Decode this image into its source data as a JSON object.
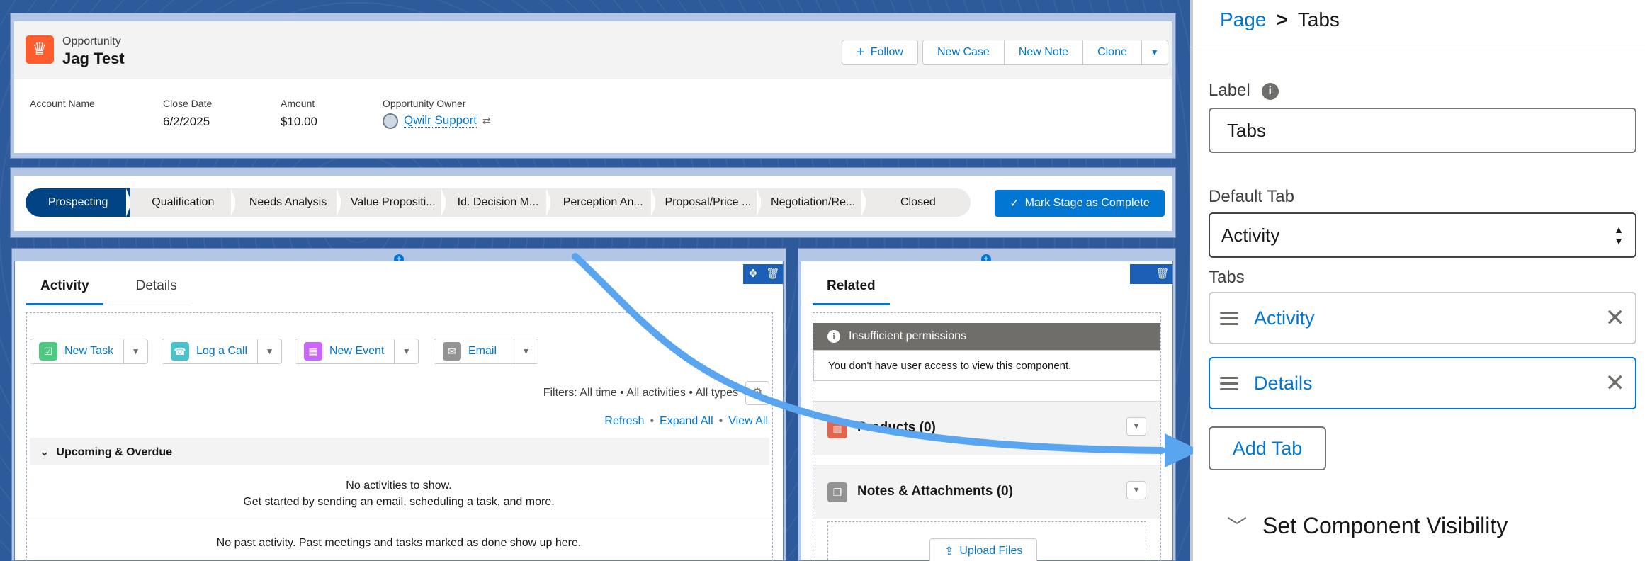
{
  "record": {
    "type": "Opportunity",
    "name": "Jag Test",
    "buttons": {
      "follow": "Follow",
      "new_case": "New Case",
      "new_note": "New Note",
      "clone": "Clone"
    },
    "fields": [
      {
        "label": "Account Name",
        "value": ""
      },
      {
        "label": "Close Date",
        "value": "6/2/2025"
      },
      {
        "label": "Amount",
        "value": "$10.00"
      },
      {
        "label": "Opportunity Owner",
        "value": "Qwilr Support"
      }
    ]
  },
  "path": {
    "steps": [
      "Prospecting",
      "Qualification",
      "Needs Analysis",
      "Value Propositi...",
      "Id. Decision M...",
      "Perception An...",
      "Proposal/Price ...",
      "Negotiation/Re...",
      "Closed"
    ],
    "complete_label": "Mark Stage as Complete"
  },
  "activity": {
    "tabs": [
      "Activity",
      "Details"
    ],
    "actions": {
      "new_task": "New Task",
      "log_call": "Log a Call",
      "new_event": "New Event",
      "email": "Email"
    },
    "filters": "Filters: All time • All activities • All types",
    "links": {
      "refresh": "Refresh",
      "expand_all": "Expand All",
      "view_all": "View All"
    },
    "section": "Upcoming & Overdue",
    "empty_title": "No activities to show.",
    "empty_sub": "Get started by sending an email, scheduling a task, and more.",
    "past": "No past activity. Past meetings and tasks marked as done show up here."
  },
  "related": {
    "tab": "Related",
    "perm_title": "Insufficient permissions",
    "perm_body": "You don't have user access to view this component.",
    "products": "Products (0)",
    "notes": "Notes & Attachments (0)",
    "upload": "Upload Files"
  },
  "panel": {
    "crumb_page": "Page",
    "crumb_sep": ">",
    "crumb_current": "Tabs",
    "label_title": "Label",
    "label_value": "Tabs",
    "default_tab_title": "Default Tab",
    "default_tab_value": "Activity",
    "tabs_title": "Tabs",
    "tabs": [
      "Activity",
      "Details"
    ],
    "add_tab": "Add Tab",
    "visibility": "Set Component Visibility"
  },
  "colors": {
    "accent": "#0176d3",
    "path_active": "#014486",
    "arrow": "#5aa5f0"
  }
}
